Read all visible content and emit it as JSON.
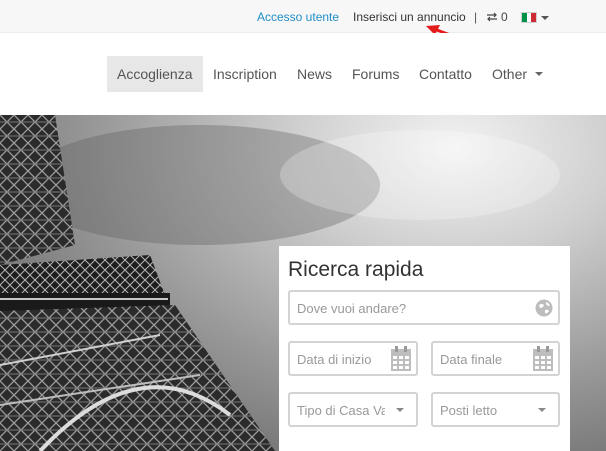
{
  "topbar": {
    "login": "Accesso utente",
    "post_ad": "Inserisci un annuncio",
    "separator": "|",
    "compare_icon": "compare-arrows-icon",
    "compare_count": "0",
    "language_flag": "italy-flag-icon"
  },
  "nav": {
    "items": [
      {
        "label": "Accoglienza",
        "active": true
      },
      {
        "label": "Inscription"
      },
      {
        "label": "News"
      },
      {
        "label": "Forums"
      },
      {
        "label": "Contatto"
      },
      {
        "label": "Other"
      }
    ]
  },
  "search": {
    "title": "Ricerca rapida",
    "where_placeholder": "Dove vuoi andare?",
    "start_placeholder": "Data di inizio",
    "end_placeholder": "Data finale",
    "type_placeholder": "Tipo di Casa Vacanza",
    "beds_placeholder": "Posti letto"
  },
  "colors": {
    "link_accent": "#1f8dc6",
    "annotation_arrow": "#e31b1b",
    "flag_green": "#009246",
    "flag_white": "#ffffff",
    "flag_red": "#ce2b37"
  }
}
